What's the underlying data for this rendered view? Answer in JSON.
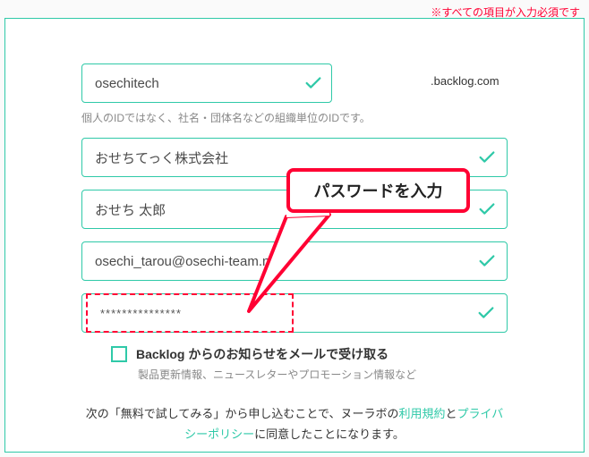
{
  "notice_text": "※すべての項目が入力必須です",
  "domain_suffix": ".backlog.com",
  "space_id_value": "osechitech",
  "space_id_helper": "個人のIDではなく、社名・団体名などの組織単位のIDです。",
  "company_value": "おせちてっく株式会社",
  "name_value": "おせち 太郎",
  "email_value": "osechi_tarou@osechi-team.net",
  "password_value": "***************",
  "callout_text": "パスワードを入力",
  "newsletter_label": "Backlog からのお知らせをメールで受け取る",
  "newsletter_helper": "製品更新情報、ニュースレターやプロモーション情報など",
  "terms_prefix": "次の「無料で試してみる」から申し込むことで、ヌーラボの",
  "terms_link1": "利用規約",
  "terms_mid": "と",
  "terms_link2": "プライバシーポリシー",
  "terms_suffix": "に同意したことになります。"
}
